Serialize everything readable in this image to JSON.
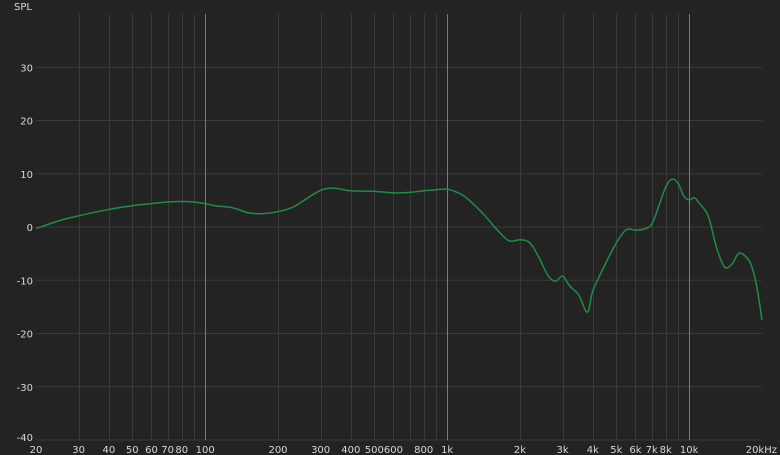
{
  "chart_data": {
    "type": "line",
    "title": "",
    "xlabel": "",
    "ylabel": "SPL",
    "xscale": "log",
    "xlim": [
      20,
      20000
    ],
    "ylim": [
      -40,
      40
    ],
    "grid": true,
    "background_color": "#232323",
    "grid_color": "#3a3a3a",
    "major_grid_color": "#7a7a7a",
    "x_ticks": [
      {
        "value": 20,
        "label": "20"
      },
      {
        "value": 30,
        "label": "30"
      },
      {
        "value": 40,
        "label": "40"
      },
      {
        "value": 50,
        "label": "50"
      },
      {
        "value": 60,
        "label": "60"
      },
      {
        "value": 70,
        "label": "70"
      },
      {
        "value": 80,
        "label": "80"
      },
      {
        "value": 100,
        "label": "100"
      },
      {
        "value": 200,
        "label": "200"
      },
      {
        "value": 300,
        "label": "300"
      },
      {
        "value": 400,
        "label": "400"
      },
      {
        "value": 500,
        "label": "500"
      },
      {
        "value": 600,
        "label": "600"
      },
      {
        "value": 800,
        "label": "800"
      },
      {
        "value": 1000,
        "label": "1k"
      },
      {
        "value": 2000,
        "label": "2k"
      },
      {
        "value": 3000,
        "label": "3k"
      },
      {
        "value": 4000,
        "label": "4k"
      },
      {
        "value": 5000,
        "label": "5k"
      },
      {
        "value": 6000,
        "label": "6k"
      },
      {
        "value": 7000,
        "label": "7k"
      },
      {
        "value": 8000,
        "label": "8k"
      },
      {
        "value": 10000,
        "label": "10k"
      },
      {
        "value": 20000,
        "label": "20kHz"
      }
    ],
    "x_major_lines": [
      100,
      1000,
      10000
    ],
    "x_minor_lines": [
      30,
      40,
      50,
      60,
      70,
      80,
      90,
      200,
      300,
      400,
      500,
      600,
      700,
      800,
      900,
      2000,
      3000,
      4000,
      5000,
      6000,
      7000,
      8000,
      9000
    ],
    "y_ticks": [
      30,
      20,
      10,
      0,
      -10,
      -20,
      -30,
      -40
    ],
    "series": [
      {
        "color": "#1f8c4a",
        "points": [
          [
            20,
            -0.3
          ],
          [
            25,
            1.2
          ],
          [
            30,
            2.1
          ],
          [
            40,
            3.3
          ],
          [
            50,
            4.0
          ],
          [
            60,
            4.4
          ],
          [
            70,
            4.7
          ],
          [
            80,
            4.8
          ],
          [
            90,
            4.7
          ],
          [
            100,
            4.4
          ],
          [
            110,
            4.0
          ],
          [
            130,
            3.6
          ],
          [
            150,
            2.7
          ],
          [
            170,
            2.5
          ],
          [
            200,
            2.9
          ],
          [
            230,
            3.7
          ],
          [
            260,
            5.2
          ],
          [
            300,
            6.9
          ],
          [
            340,
            7.3
          ],
          [
            400,
            6.8
          ],
          [
            500,
            6.7
          ],
          [
            600,
            6.4
          ],
          [
            700,
            6.5
          ],
          [
            800,
            6.8
          ],
          [
            900,
            7.0
          ],
          [
            1000,
            7.1
          ],
          [
            1100,
            6.5
          ],
          [
            1200,
            5.5
          ],
          [
            1400,
            2.6
          ],
          [
            1600,
            -0.4
          ],
          [
            1800,
            -2.6
          ],
          [
            2000,
            -2.4
          ],
          [
            2200,
            -3.0
          ],
          [
            2400,
            -5.8
          ],
          [
            2600,
            -9.0
          ],
          [
            2800,
            -10.2
          ],
          [
            3000,
            -9.2
          ],
          [
            3200,
            -11.0
          ],
          [
            3500,
            -12.8
          ],
          [
            3800,
            -16.0
          ],
          [
            4000,
            -12.0
          ],
          [
            4500,
            -7.0
          ],
          [
            5000,
            -3.0
          ],
          [
            5500,
            -0.5
          ],
          [
            6000,
            -0.6
          ],
          [
            6500,
            -0.4
          ],
          [
            7000,
            0.5
          ],
          [
            7500,
            4.0
          ],
          [
            8000,
            7.5
          ],
          [
            8500,
            9.0
          ],
          [
            9000,
            8.2
          ],
          [
            9500,
            5.8
          ],
          [
            10000,
            5.1
          ],
          [
            10500,
            5.5
          ],
          [
            11000,
            4.5
          ],
          [
            12000,
            2.0
          ],
          [
            13000,
            -4.0
          ],
          [
            14000,
            -7.5
          ],
          [
            15000,
            -7.0
          ],
          [
            16000,
            -5.0
          ],
          [
            17000,
            -5.4
          ],
          [
            18000,
            -7.0
          ],
          [
            19000,
            -11.0
          ],
          [
            20000,
            -17.5
          ]
        ]
      }
    ]
  }
}
